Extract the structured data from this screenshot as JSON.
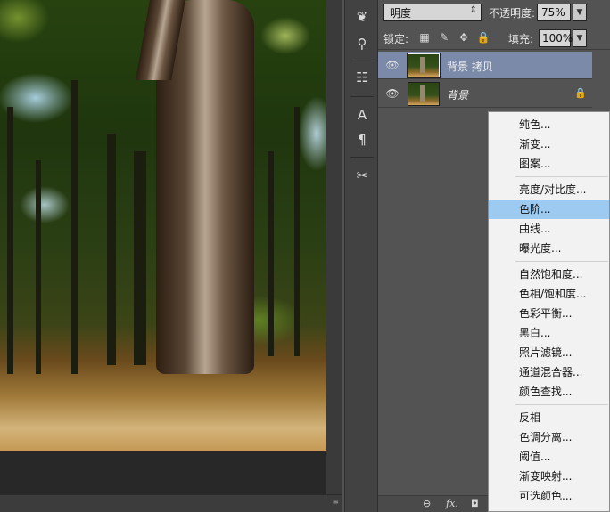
{
  "canvas": {
    "image_alt": "",
    "corner_glyph": "≡"
  },
  "tools": [
    {
      "name": "brush-settings-icon",
      "glyph": "❦"
    },
    {
      "name": "clone-source-icon",
      "glyph": "⚲"
    },
    {
      "name": "tool-presets-icon",
      "glyph": "☷"
    },
    {
      "name": "character-icon",
      "glyph": "A"
    },
    {
      "name": "paragraph-icon",
      "glyph": "¶"
    },
    {
      "name": "tools-icon",
      "glyph": "✂"
    }
  ],
  "layers_panel": {
    "blend_mode": "明度",
    "opacity_label": "不透明度:",
    "opacity_value": "75%",
    "lock_label": "锁定:",
    "fill_label": "填充:",
    "fill_value": "100%",
    "layers": [
      {
        "name": "背景 拷贝",
        "selected": true,
        "locked": false
      },
      {
        "name": "背景",
        "selected": false,
        "locked": true
      }
    ],
    "bottom_icons": [
      "link-icon",
      "fx-icon",
      "mask-icon"
    ],
    "bottom_labels": {
      "link": "⊖",
      "fx": "fx.",
      "mask": "◘"
    }
  },
  "adjustment_menu": {
    "groups": [
      [
        "纯色...",
        "渐变...",
        "图案..."
      ],
      [
        "亮度/对比度...",
        "色阶...",
        "曲线...",
        "曝光度..."
      ],
      [
        "自然饱和度...",
        "色相/饱和度...",
        "色彩平衡...",
        "黑白...",
        "照片滤镜...",
        "通道混合器...",
        "颜色查找..."
      ],
      [
        "反相",
        "色调分离...",
        "阈值...",
        "渐变映射...",
        "可选颜色..."
      ]
    ],
    "hover_item": "色阶..."
  },
  "glyphs": {
    "eye": "👁",
    "lock": "🔒",
    "dropdown": "⇕",
    "arrow_down": "▼",
    "lock_pixels": "▦",
    "lock_brush": "✎",
    "lock_move": "✥",
    "lock_all": "🔒"
  },
  "colors": {
    "selected_layer": "#7a8aa8",
    "menu_hover": "#9ccaf0",
    "panel_bg": "#535353"
  }
}
